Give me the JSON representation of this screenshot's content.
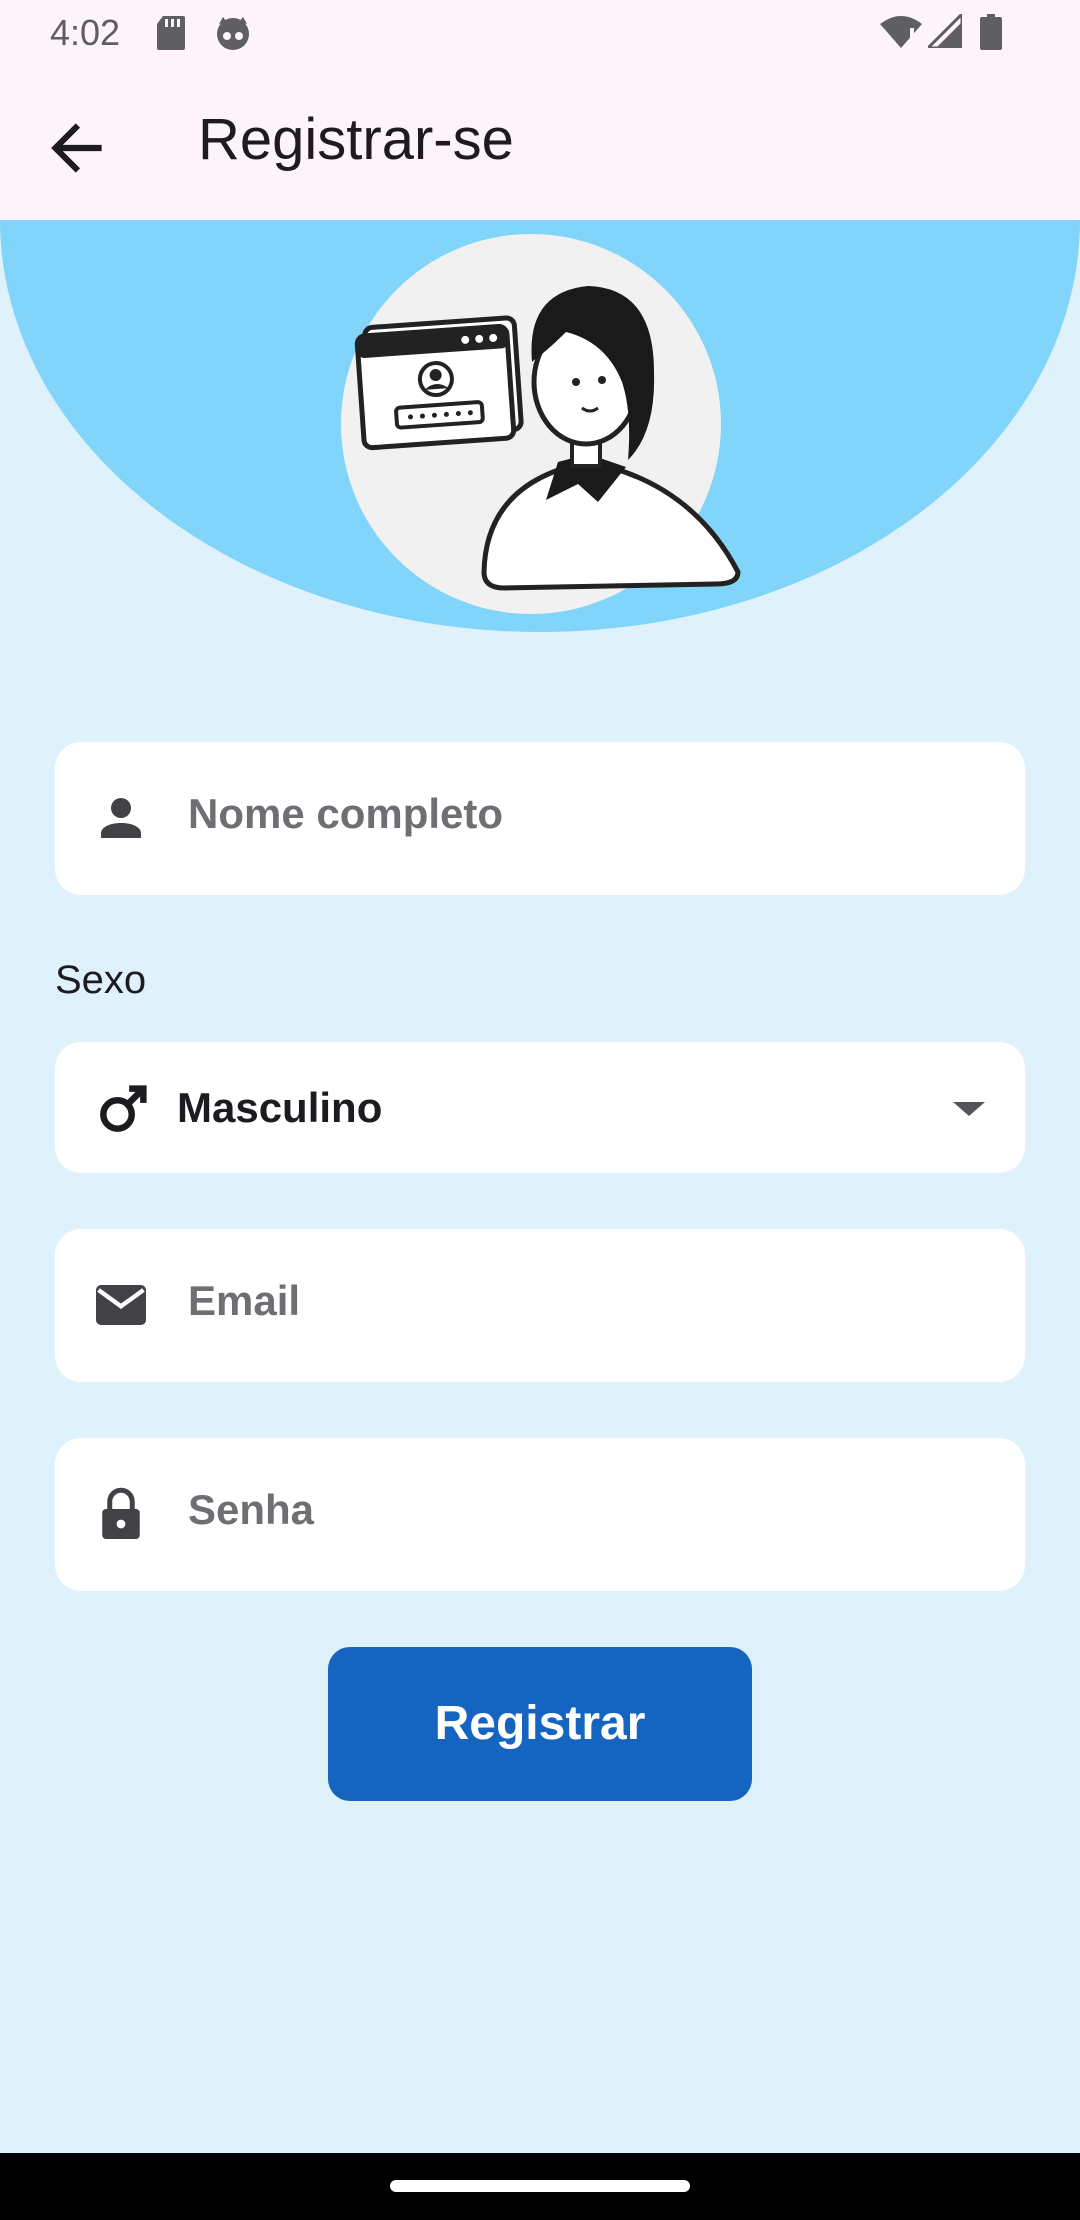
{
  "status_bar": {
    "time": "4:02",
    "icons": [
      "sd-card-icon",
      "notification-cat-icon",
      "wifi-icon",
      "signal-icon",
      "battery-icon"
    ]
  },
  "app_bar": {
    "title": "Registrar-se",
    "back_icon": "arrow-back-icon"
  },
  "hero": {
    "illustration": "user-login-illustration",
    "background_color": "#81d4fa"
  },
  "form": {
    "name_field": {
      "placeholder": "Nome completo",
      "icon": "person-icon"
    },
    "gender_label": "Sexo",
    "gender_select": {
      "selected": "Masculino",
      "icon": "male-icon"
    },
    "email_field": {
      "placeholder": "Email",
      "icon": "mail-icon"
    },
    "password_field": {
      "placeholder": "Senha",
      "icon": "lock-icon"
    },
    "submit_label": "Registrar"
  },
  "colors": {
    "page_background": "#dff2fb",
    "app_bar_background": "#fcf3fb",
    "primary_button": "#1565c0"
  }
}
